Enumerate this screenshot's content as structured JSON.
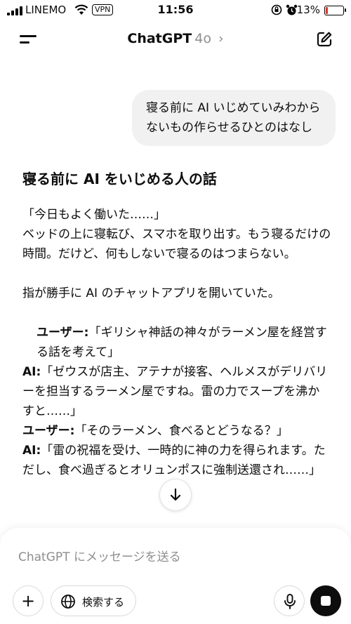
{
  "status_bar": {
    "carrier": "LINEMO",
    "vpn": "VPN",
    "time": "11:56",
    "battery_percent": "13%",
    "battery_level": 0.13,
    "battery_color": "#e0352b"
  },
  "header": {
    "title": "ChatGPT",
    "model": "4o",
    "chevron": "›"
  },
  "conversation": {
    "user_message": "寝る前に AI いじめていみわからないもの作らせるひとのはなし",
    "answer": {
      "heading": "寝る前に AI をいじめる人の話",
      "p1": "「今日もよく働いた……」",
      "p2": "ベッドの上に寝転び、スマホを取り出す。もう寝るだけの時間。だけど、何もしないで寝るのはつまらない。",
      "p3": "指が勝手に AI のチャットアプリを開いていた。",
      "d1_speaker": "ユーザー:",
      "d1_text": "「ギリシャ神話の神々がラーメン屋を経営する話を考えて」",
      "d2_speaker": "AI:",
      "d2_text": "「ゼウスが店主、アテナが接客、ヘルメスがデリバリーを担当するラーメン屋ですね。雷の力でスープを沸かすと……」",
      "d3_speaker": "ユーザー:",
      "d3_text": "「そのラーメン、食べるとどうなる？」",
      "d4_speaker": "AI:",
      "d4_text": "「雷の祝福を受け、一時的に神の力を得られます。ただし、食べ過ぎるとオリュンポスに強制送還され……」"
    }
  },
  "composer": {
    "placeholder": "ChatGPT にメッセージを送る",
    "plus_label": "+",
    "search_label": "検索する"
  },
  "icons": {
    "menu": "menu-icon",
    "edit": "new-chat-icon",
    "scroll": "arrow-down-icon",
    "globe": "globe-icon",
    "mic": "microphone-icon",
    "stop": "stop-icon"
  }
}
